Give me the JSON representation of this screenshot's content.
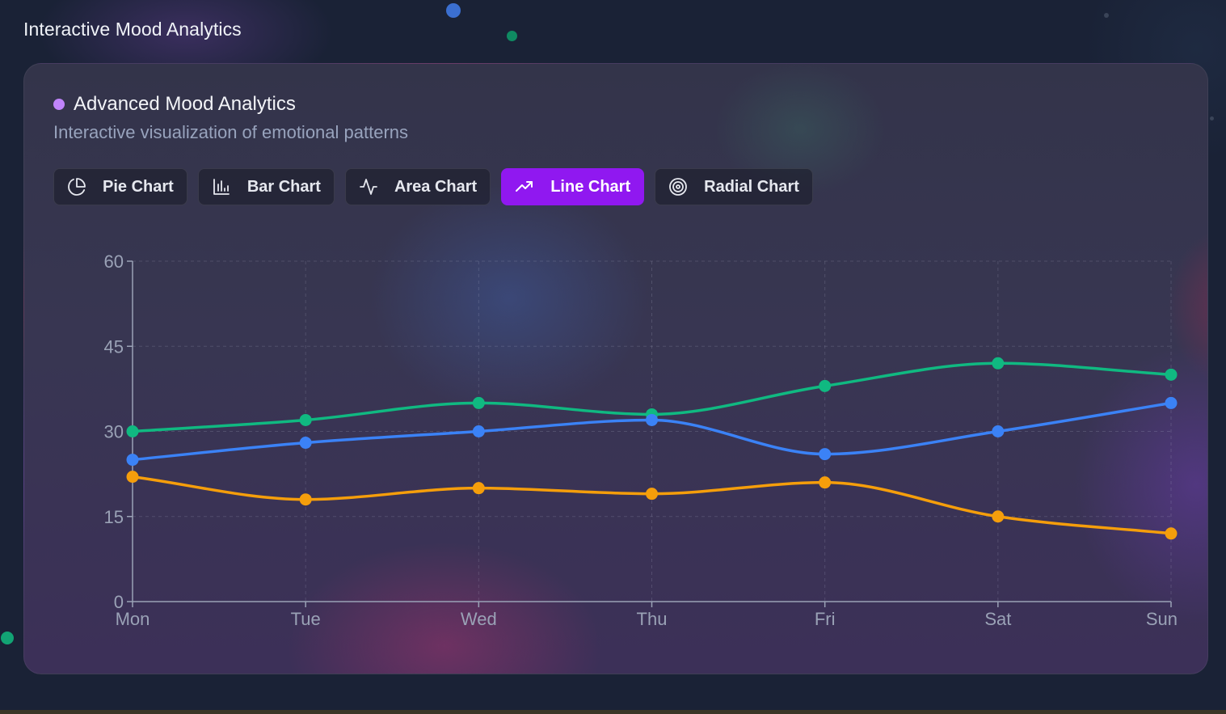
{
  "page": {
    "title": "Interactive Mood Analytics"
  },
  "card": {
    "title": "Advanced Mood Analytics",
    "subtitle": "Interactive visualization of emotional patterns"
  },
  "tabs": [
    {
      "label": "Pie Chart",
      "icon": "pie-chart-icon",
      "active": false
    },
    {
      "label": "Bar Chart",
      "icon": "bar-chart-icon",
      "active": false
    },
    {
      "label": "Area Chart",
      "icon": "activity-icon",
      "active": false
    },
    {
      "label": "Line Chart",
      "icon": "trending-up-icon",
      "active": true
    },
    {
      "label": "Radial Chart",
      "icon": "target-icon",
      "active": false
    }
  ],
  "colors": {
    "accent": "#9018f0",
    "green": "#10b981",
    "blue": "#3b82f6",
    "orange": "#f59e0b",
    "title_dot": "#c084fc"
  },
  "chart_data": {
    "type": "line",
    "categories": [
      "Mon",
      "Tue",
      "Wed",
      "Thu",
      "Fri",
      "Sat",
      "Sun"
    ],
    "yticks": [
      "0",
      "15",
      "30",
      "45",
      "60"
    ],
    "ylim": [
      0,
      60
    ],
    "grid": true,
    "series": [
      {
        "color": "#10b981",
        "values": [
          30,
          32,
          35,
          33,
          38,
          42,
          40
        ]
      },
      {
        "color": "#3b82f6",
        "values": [
          25,
          28,
          30,
          32,
          26,
          30,
          35
        ]
      },
      {
        "color": "#f59e0b",
        "values": [
          22,
          18,
          20,
          19,
          21,
          15,
          12
        ]
      }
    ]
  }
}
